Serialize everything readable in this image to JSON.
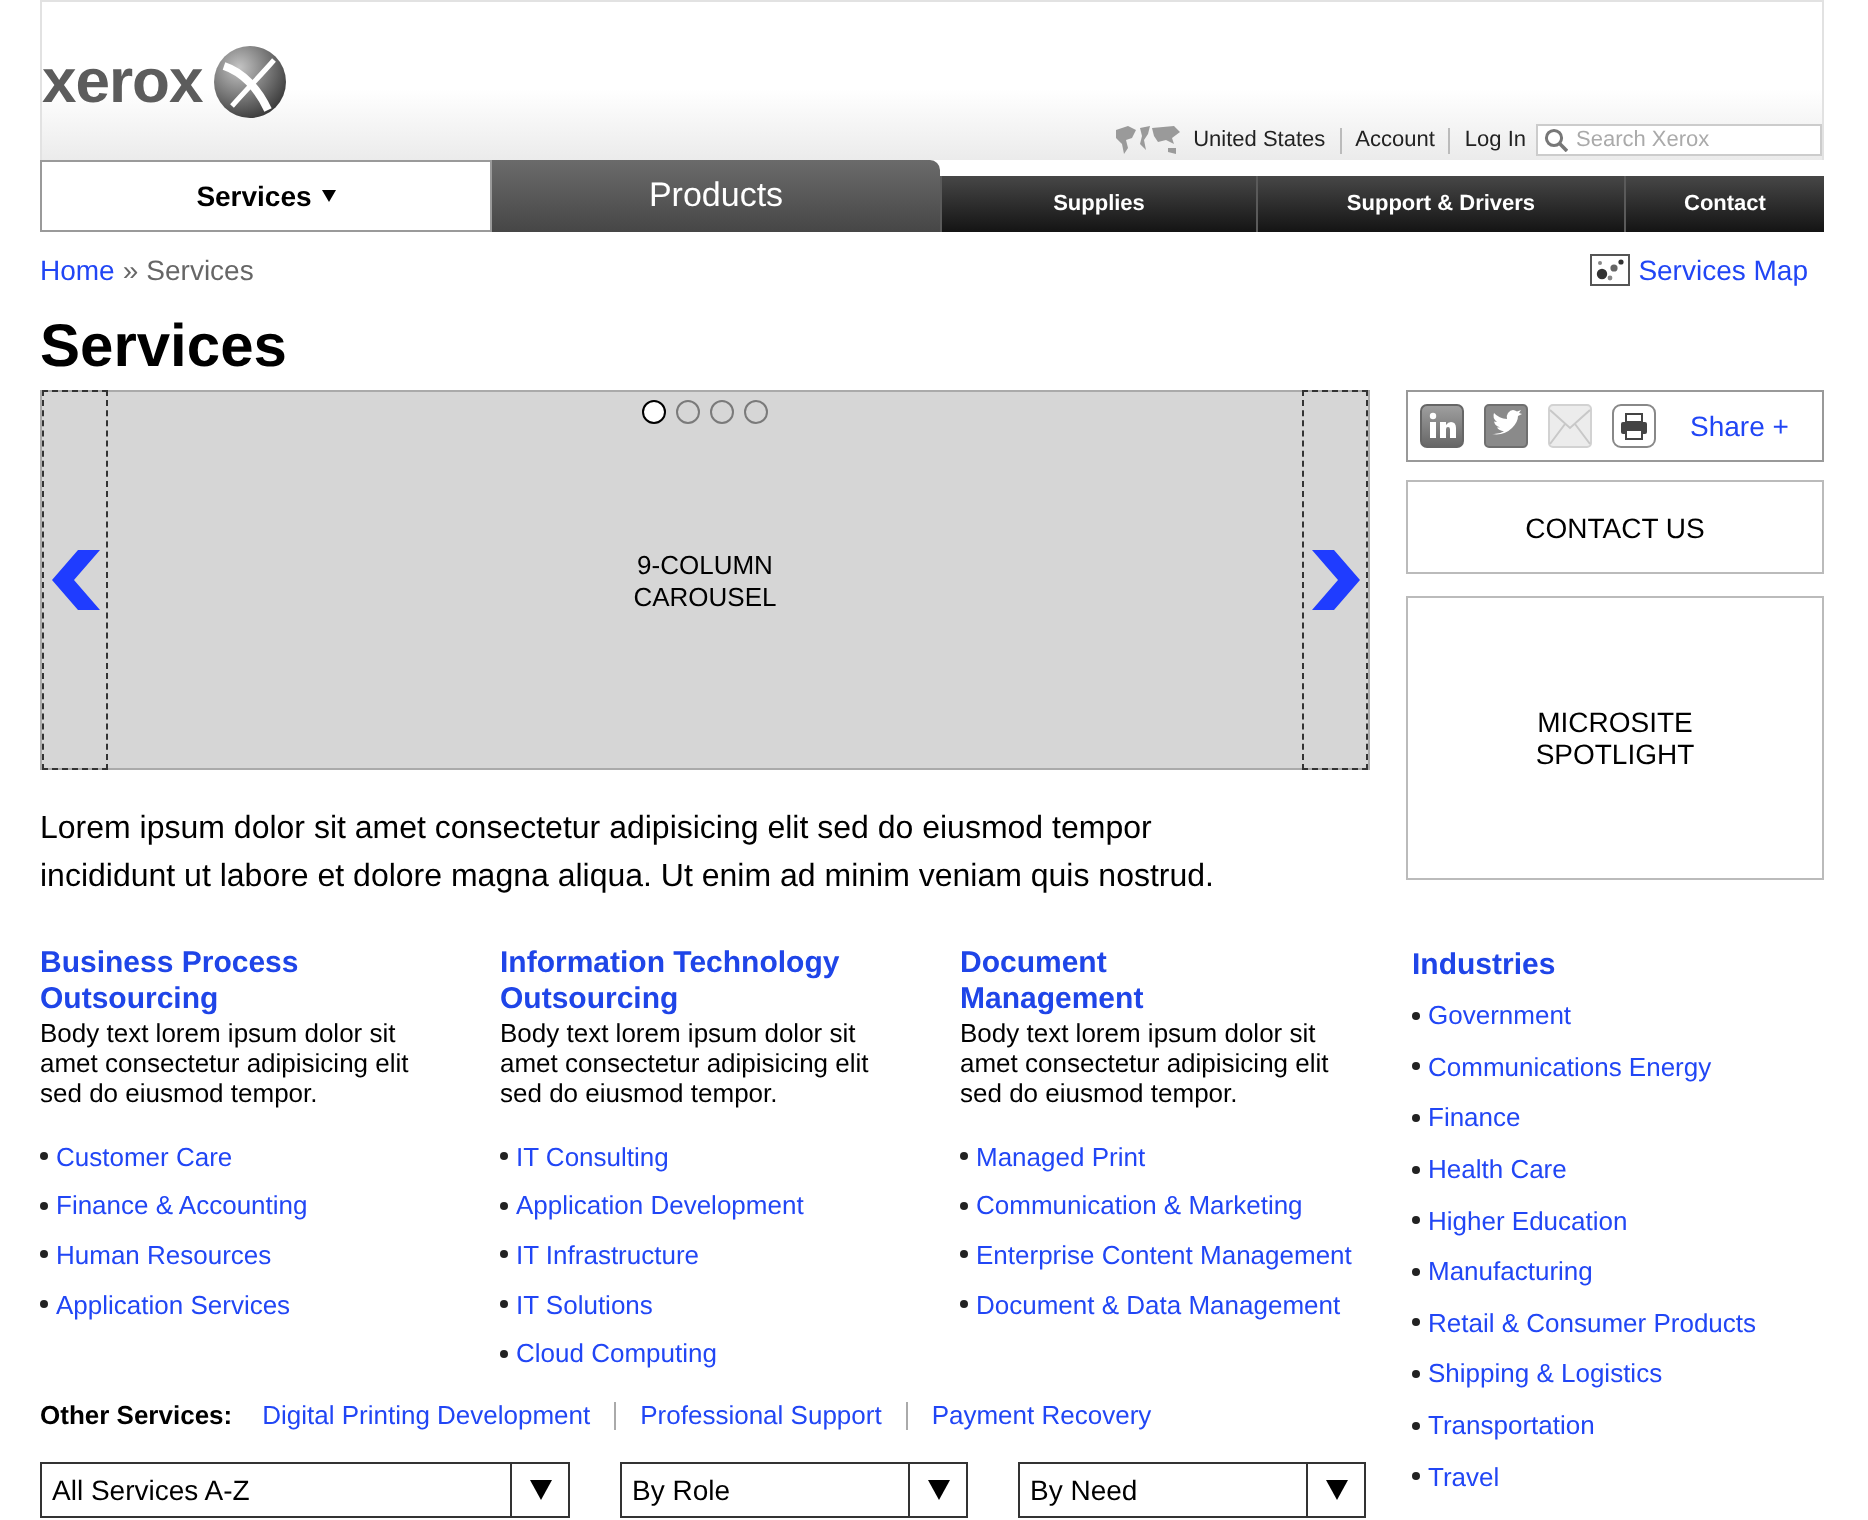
{
  "header": {
    "logo": "xerox",
    "utility_links": [
      {
        "label": "United States",
        "kind": "country"
      },
      {
        "label": "Account",
        "kind": "link"
      },
      {
        "label": "Log In",
        "kind": "link"
      }
    ],
    "search": {
      "placeholder": "Search Xerox"
    }
  },
  "nav": [
    {
      "label": "Services",
      "kind": "main",
      "selected": true,
      "dropdown": true
    },
    {
      "label": "Products",
      "kind": "main",
      "selected": false,
      "dropdown": false
    },
    {
      "label": "Supplies",
      "kind": "sub",
      "selected": false,
      "dropdown": false
    },
    {
      "label": "Support & Drivers",
      "kind": "sub",
      "selected": false,
      "dropdown": false
    },
    {
      "label": "Contact",
      "kind": "sub",
      "selected": false,
      "dropdown": false
    }
  ],
  "breadcrumb": {
    "items": [
      {
        "label": "Home",
        "kind": "link"
      },
      {
        "label": "Services",
        "kind": "current"
      }
    ],
    "separator": "»",
    "map_link": "Services Map"
  },
  "title": "Services",
  "carousel": {
    "label": "9-COLUMN\nCAROUSEL",
    "dots": [
      {
        "selected": true
      },
      {
        "selected": false
      },
      {
        "selected": false
      },
      {
        "selected": false
      }
    ]
  },
  "intro": "Lorem ipsum dolor sit amet consectetur adipisicing elit sed do eiusmod tempor incididunt ut labore et dolore magna aliqua. Ut enim ad minim veniam quis nostrud.",
  "sections": [
    {
      "title": "Business Process\nOutsourcing",
      "body": "Body text lorem ipsum dolor sit amet consectetur adipisicing elit sed do eiusmod tempor.",
      "links": [
        "Customer Care",
        "Finance & Accounting",
        "Human Resources",
        "Application Services"
      ]
    },
    {
      "title": "Information Technology\nOutsourcing",
      "body": "Body text lorem ipsum dolor sit amet consectetur adipisicing elit sed do eiusmod tempor.",
      "links": [
        "IT Consulting",
        "Application Development",
        "IT Infrastructure",
        "IT Solutions",
        "Cloud Computing"
      ]
    },
    {
      "title": "Document\nManagement",
      "body": "Body text lorem ipsum dolor sit amet consectetur adipisicing elit sed do eiusmod tempor.",
      "links": [
        "Managed Print",
        "Communication & Marketing",
        "Enterprise Content Management",
        "Document & Data Management"
      ]
    }
  ],
  "other_services": {
    "label": "Other Services:",
    "links": [
      "Digital Printing Development",
      "Professional Support",
      "Payment Recovery"
    ]
  },
  "dropdowns": [
    {
      "value": "All Services A-Z"
    },
    {
      "value": "By Role"
    },
    {
      "value": "By Need"
    }
  ],
  "sidebar": {
    "share_label": "Share +",
    "contact": "CONTACT US",
    "spotlight": "MICROSITE\nSPOTLIGHT",
    "industries": {
      "title": "Industries",
      "items": [
        "Government",
        "Communications Energy",
        "Finance",
        "Health Care",
        "Higher Education",
        "Manufacturing",
        "Retail & Consumer Products",
        "Shipping & Logistics",
        "Transportation",
        "Travel"
      ]
    }
  }
}
